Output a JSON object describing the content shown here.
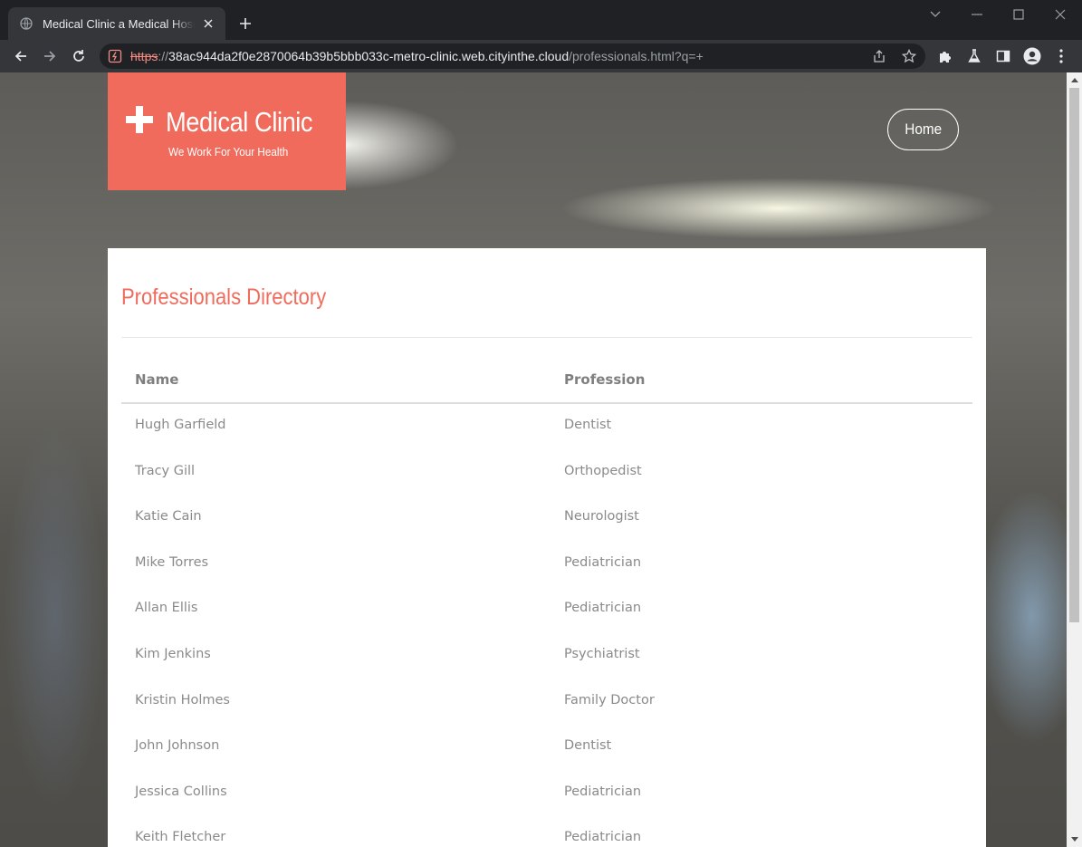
{
  "browser": {
    "tab": {
      "title": "Medical Clinic a Medical Hospital"
    },
    "address": {
      "scheme": "https",
      "separator": "://",
      "host": "38ac944da2f0e2870064b39b5bbb033c-metro-clinic.web.cityinthe.cloud",
      "path": "/professionals.html?q=+"
    }
  },
  "header": {
    "brand_title": "Medical Clinic",
    "brand_tagline": "We Work For Your Health",
    "nav_home": "Home"
  },
  "directory": {
    "title": "Professionals Directory",
    "columns": [
      "Name",
      "Profession"
    ],
    "rows": [
      {
        "name": "Hugh Garfield",
        "profession": "Dentist"
      },
      {
        "name": "Tracy Gill",
        "profession": "Orthopedist"
      },
      {
        "name": "Katie Cain",
        "profession": "Neurologist"
      },
      {
        "name": "Mike Torres",
        "profession": "Pediatrician"
      },
      {
        "name": "Allan Ellis",
        "profession": "Pediatrician"
      },
      {
        "name": "Kim Jenkins",
        "profession": "Psychiatrist"
      },
      {
        "name": "Kristin Holmes",
        "profession": "Family Doctor"
      },
      {
        "name": "John Johnson",
        "profession": "Dentist"
      },
      {
        "name": "Jessica Collins",
        "profession": "Pediatrician"
      },
      {
        "name": "Keith Fletcher",
        "profession": "Pediatrician"
      }
    ]
  },
  "colors": {
    "accent": "#f06b5c",
    "panel": "#ffffff",
    "text": "#8a8a8a"
  }
}
